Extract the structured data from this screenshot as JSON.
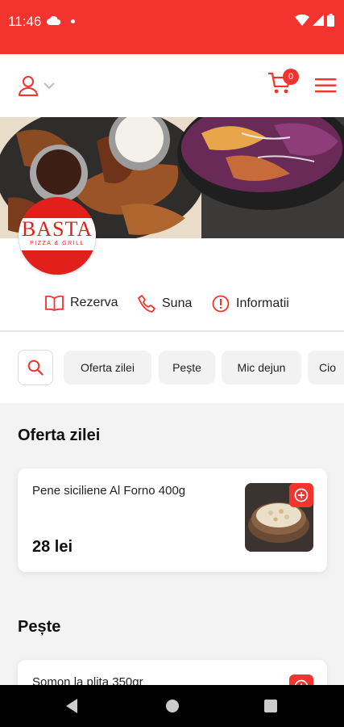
{
  "status_bar": {
    "time": "11:46",
    "icons": [
      "cloud-icon",
      "dot-icon",
      "wifi-icon",
      "signal-icon",
      "battery-icon"
    ]
  },
  "header": {
    "user_icon": "user-icon",
    "dropdown_icon": "chevron-down-icon",
    "cart_icon": "cart-icon",
    "cart_count": "0",
    "menu_icon": "hamburger-menu-icon"
  },
  "restaurant": {
    "logo_name": "BASTA",
    "logo_sub": "PIZZA & GRILL"
  },
  "actions": [
    {
      "label": "Rezerva",
      "icon": "book-icon"
    },
    {
      "label": "Suna",
      "icon": "phone-icon"
    },
    {
      "label": "Informatii",
      "icon": "info-icon"
    }
  ],
  "filters": {
    "search_icon": "search-icon",
    "chips": [
      "Oferta zilei",
      "Pește",
      "Mic dejun",
      "Cio"
    ]
  },
  "sections": [
    {
      "title": "Oferta zilei",
      "items": [
        {
          "name": "Pene siciliene Al Forno 400g",
          "price": "28 lei"
        }
      ]
    },
    {
      "title": "Pește",
      "items": [
        {
          "name": "Somon la plita 350gr",
          "price": ""
        }
      ]
    }
  ],
  "colors": {
    "brand": "#f2332e",
    "chip_bg": "#f2f2f2",
    "page_bg": "#f3f3f3"
  }
}
